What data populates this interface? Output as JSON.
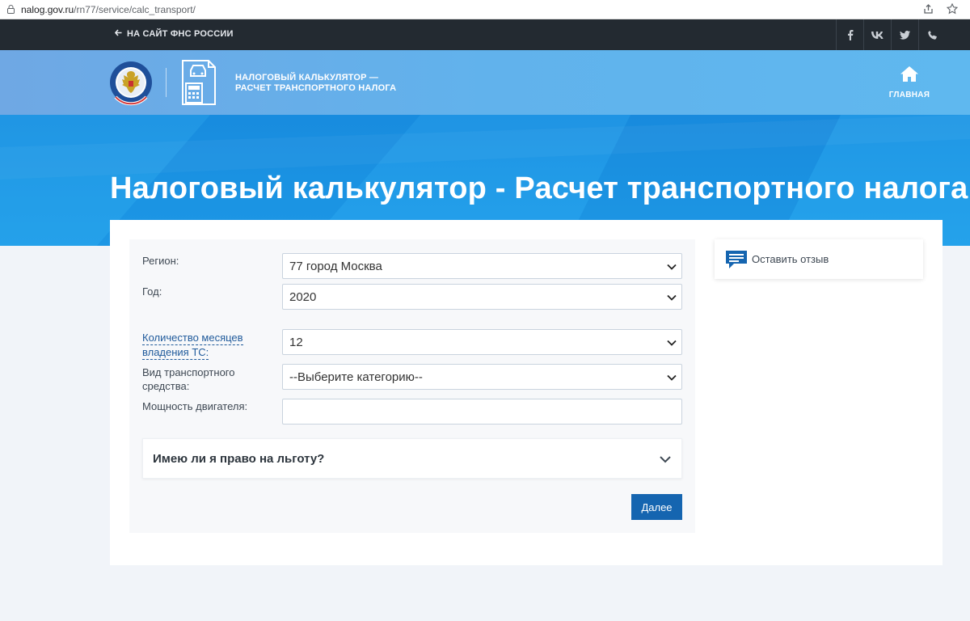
{
  "browser": {
    "url_host": "nalog.gov.ru",
    "url_path": "/rn77/service/calc_transport/"
  },
  "topbar": {
    "back_label": "НА САЙТ ФНС РОССИИ",
    "social": [
      "f",
      "vk",
      "twitter",
      "phone"
    ]
  },
  "header": {
    "service_title_line1": "НАЛОГОВЫЙ КАЛЬКУЛЯТОР —",
    "service_title_line2": "РАСЧЕТ ТРАНСПОРТНОГО НАЛОГА",
    "home_label": "ГЛАВНАЯ"
  },
  "hero": {
    "title": "Налоговый калькулятор - Расчет транспортного налога"
  },
  "form": {
    "region": {
      "label": "Регион:",
      "value": "77 город Москва"
    },
    "year": {
      "label": "Год:",
      "value": "2020"
    },
    "months": {
      "label_line1": "Количество месяцев",
      "label_line2": "владения ТС:",
      "value": "12"
    },
    "vehicle_type": {
      "label_line1": "Вид транспортного",
      "label_line2": "средства:",
      "value": "--Выберите категорию--"
    },
    "engine_power": {
      "label": "Мощность двигателя:",
      "value": ""
    },
    "benefit_question": "Имею ли я право на льготу?",
    "next_button": "Далее"
  },
  "sidebar": {
    "feedback_label": "Оставить отзыв"
  },
  "colors": {
    "topbar": "#232a31",
    "header": "#61b2ec",
    "hero": "#1f9ae6",
    "primary_button": "#1565b0",
    "link": "#1f5a9b"
  }
}
